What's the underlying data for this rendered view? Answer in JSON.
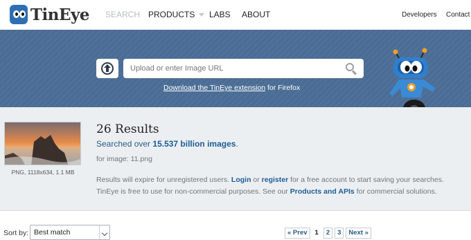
{
  "nav": {
    "logo_text": "TinEye",
    "links": [
      "SEARCH",
      "PRODUCTS",
      "LABS",
      "ABOUT"
    ],
    "right_links": [
      "Developers",
      "Contact"
    ],
    "active_color": "#b8bcc2"
  },
  "hero": {
    "upload_icon": "upload-arrow-icon",
    "search_placeholder": "Upload or enter Image URL",
    "extension_link": "Download the TinEye extension",
    "extension_suffix": " for Firefox",
    "background_color": "#4b6d95"
  },
  "results": {
    "title": "26 Results",
    "searched_prefix": "Searched over ",
    "searched_count": "15.537 billion images",
    "searched_suffix": ".",
    "for_image": "for image: 11.png",
    "thumb_caption": "PNG, 1118x634, 1.1 MB",
    "expire_text_1": "Results will expire for unregistered users. ",
    "login_link": "Login",
    "expire_text_2": " or ",
    "register_link": "register",
    "expire_text_3": " for a free account to start saving your searches.",
    "free_text_1": "TinEye is free to use for non-commercial purposes. See our ",
    "products_link": "Products and APIs",
    "free_text_2": " for commercial solutions."
  },
  "controls": {
    "sort_label": "Sort by:",
    "sort_value": "Best match",
    "pagination": {
      "prev": "« Prev",
      "pages": [
        "1",
        "2",
        "3"
      ],
      "current": "1",
      "next": "Next »"
    }
  }
}
